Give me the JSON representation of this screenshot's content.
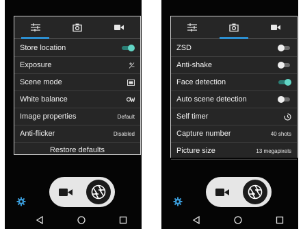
{
  "screens": [
    {
      "tabs": [
        {
          "icon": "sliders-icon",
          "active": true
        },
        {
          "icon": "camera-icon",
          "active": false
        },
        {
          "icon": "video-icon",
          "active": false
        }
      ],
      "rows": [
        {
          "label": "Store location",
          "control": "toggle",
          "state": "on"
        },
        {
          "label": "Exposure",
          "control": "icon",
          "icon": "exposure-icon"
        },
        {
          "label": "Scene mode",
          "control": "icon",
          "icon": "scene-mode-icon"
        },
        {
          "label": "White balance",
          "control": "icon",
          "icon": "white-balance-icon"
        },
        {
          "label": "Image properties",
          "control": "text",
          "value": "Default"
        },
        {
          "label": "Anti-flicker",
          "control": "text",
          "value": "Disabled"
        }
      ],
      "restore_label": "Restore defaults"
    },
    {
      "tabs": [
        {
          "icon": "sliders-icon",
          "active": false
        },
        {
          "icon": "camera-icon",
          "active": true
        },
        {
          "icon": "video-icon",
          "active": false
        }
      ],
      "rows": [
        {
          "label": "ZSD",
          "control": "toggle",
          "state": "off"
        },
        {
          "label": "Anti-shake",
          "control": "toggle",
          "state": "off"
        },
        {
          "label": "Face detection",
          "control": "toggle",
          "state": "on"
        },
        {
          "label": "Auto scene detection",
          "control": "toggle",
          "state": "off"
        },
        {
          "label": "Self timer",
          "control": "icon",
          "icon": "timer-icon"
        },
        {
          "label": "Capture number",
          "control": "text",
          "value": "40 shots"
        },
        {
          "label": "Picture size",
          "control": "text",
          "value": "13 megapixels"
        }
      ]
    }
  ],
  "bottom": {
    "icons": [
      "video-camera-icon",
      "shutter-icon",
      "settings-gear-icon"
    ],
    "nav": [
      "back-icon",
      "home-icon",
      "recent-apps-icon"
    ]
  },
  "colors": {
    "accent_blue": "#2c8fd1",
    "toggle_on": "#62d6c6",
    "panel_bg": "#262626",
    "screen_bg": "#050505",
    "gear_blue": "#3a9bd8"
  }
}
